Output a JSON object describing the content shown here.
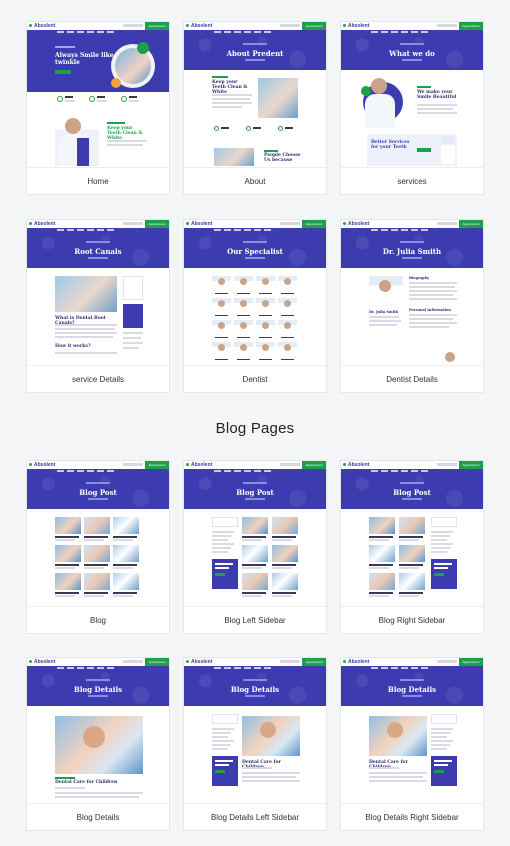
{
  "section_title": "Blog Pages",
  "pages": [
    {
      "id": "home",
      "caption": "Home"
    },
    {
      "id": "about",
      "caption": "About",
      "hero": "About Predent"
    },
    {
      "id": "services",
      "caption": "services",
      "hero": "What we do"
    },
    {
      "id": "service-details",
      "caption": "service Details",
      "hero": "Root Canals"
    },
    {
      "id": "dentist",
      "caption": "Dentist",
      "hero": "Our Specialist"
    },
    {
      "id": "dentist-details",
      "caption": "Dentist Details",
      "hero": "Dr. Julia Smith"
    },
    {
      "id": "blog",
      "caption": "Blog",
      "hero": "Blog Post"
    },
    {
      "id": "blog-left",
      "caption": "Blog Left Sidebar",
      "hero": "Blog Post"
    },
    {
      "id": "blog-right",
      "caption": "Blog Right Sidebar",
      "hero": "Blog Post"
    },
    {
      "id": "blog-details",
      "caption": "Blog Details",
      "hero": "Blog Details"
    },
    {
      "id": "blog-details-left",
      "caption": "Blog Details Left Sidebar",
      "hero": "Blog Details"
    },
    {
      "id": "blog-details-right",
      "caption": "Blog Details Right Sidebar",
      "hero": "Blog Details"
    }
  ],
  "mini": {
    "logo": "Absolent",
    "appointment": "Appointment",
    "home_hero": "Always Smile like twinkle",
    "home_sub": "Keep your Teeth Clean & White",
    "about_sub": "Keep your Teeth Clean & White",
    "about_sub2": "People Choose Us because",
    "services_sub": "We make your Smile Beautiful",
    "services_sub2": "Better Services for your Teeth",
    "sd_q": "What is Dental Root Canals?",
    "sd_q2": "How it works?",
    "dd_name": "Dr. Julia Smith",
    "dd_bio": "Biography",
    "dd_info": "Personal Information",
    "bd_title": "Dental Care for Children",
    "sb_title": "The Most Beautiful Smile"
  },
  "colors": {
    "brand": "#3c3cb0",
    "accent": "#1fa048",
    "text": "#333333",
    "bg": "#f4f5f7"
  }
}
